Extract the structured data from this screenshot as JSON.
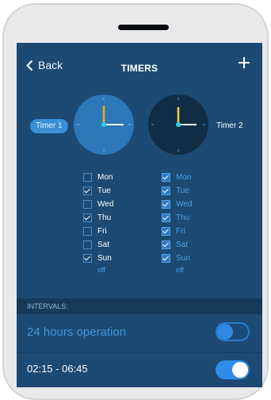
{
  "header": {
    "back_label": "Back",
    "title": "TIMERS",
    "add_icon": "plus-icon"
  },
  "timers": [
    {
      "label": "Timer 1",
      "selected": true,
      "face_color": "#2e77b8",
      "days": [
        {
          "name": "Mon",
          "checked": false
        },
        {
          "name": "Tue",
          "checked": true
        },
        {
          "name": "Wed",
          "checked": false
        },
        {
          "name": "Thu",
          "checked": true
        },
        {
          "name": "Fri",
          "checked": false
        },
        {
          "name": "Sat",
          "checked": false
        },
        {
          "name": "Sun",
          "checked": true
        }
      ],
      "status": "off"
    },
    {
      "label": "Timer 2",
      "selected": false,
      "face_color": "#102d45",
      "days": [
        {
          "name": "Mon",
          "checked": true
        },
        {
          "name": "Tue",
          "checked": true
        },
        {
          "name": "Wed",
          "checked": true
        },
        {
          "name": "Thu",
          "checked": true
        },
        {
          "name": "Fri",
          "checked": true
        },
        {
          "name": "Sat",
          "checked": true
        },
        {
          "name": "Sun",
          "checked": true
        }
      ],
      "status": "off"
    }
  ],
  "intervals": {
    "header": "INTERVALS:",
    "rows": [
      {
        "label": "24 hours operation",
        "on": false
      },
      {
        "label": "02:15 - 06:45",
        "on": true
      }
    ]
  },
  "colors": {
    "screen_bg": "#1c4a73",
    "accent": "#2f8ae8",
    "hour_hand": "#f5a623",
    "hour_hand_2": "#f2d63a"
  }
}
